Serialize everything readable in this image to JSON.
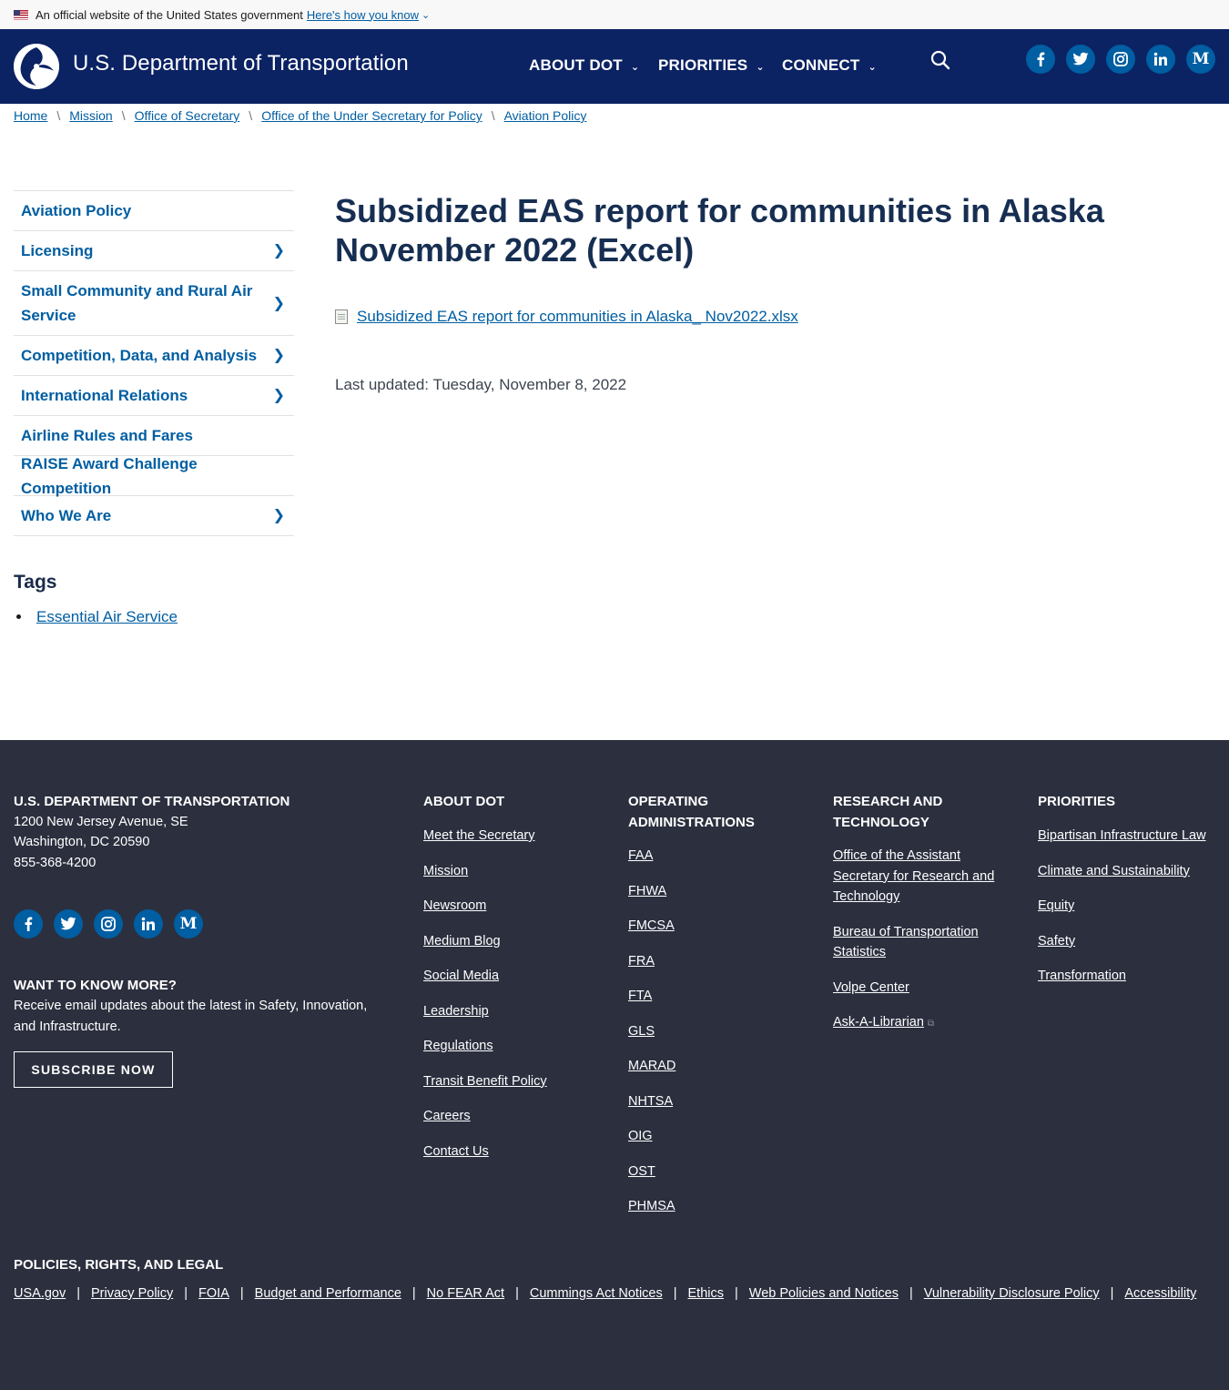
{
  "gov_banner": {
    "text": "An official website of the United States government",
    "link": "Here's how you know"
  },
  "header": {
    "site_title": "U.S. Department of Transportation",
    "nav": [
      {
        "label": "ABOUT DOT"
      },
      {
        "label": "PRIORITIES"
      },
      {
        "label": "CONNECT"
      }
    ],
    "social": [
      "facebook-icon",
      "twitter-icon",
      "instagram-icon",
      "linkedin-icon",
      "medium-icon"
    ]
  },
  "breadcrumb": [
    "Home",
    "Mission",
    "Office of Secretary",
    "Office of the Under Secretary for Policy",
    "Aviation Policy"
  ],
  "sidebar": {
    "items": [
      {
        "label": "Aviation Policy",
        "has_children": false
      },
      {
        "label": "Licensing",
        "has_children": true
      },
      {
        "label": "Small Community and Rural Air Service",
        "has_children": true
      },
      {
        "label": "Competition, Data, and Analysis",
        "has_children": true
      },
      {
        "label": "International Relations",
        "has_children": true
      },
      {
        "label": "Airline Rules and Fares",
        "has_children": false
      },
      {
        "label": "RAISE Award Challenge Competition",
        "has_children": false
      },
      {
        "label": "Who We Are",
        "has_children": true
      }
    ],
    "tags_title": "Tags",
    "tags": [
      "Essential Air Service"
    ]
  },
  "main": {
    "title": "Subsidized EAS report for communities in Alaska November 2022 (Excel)",
    "file_link": "Subsidized EAS report for communities in Alaska_ Nov2022.xlsx",
    "last_updated": "Last updated: Tuesday, November 8, 2022"
  },
  "footer": {
    "org_title": "U.S. DEPARTMENT OF TRANSPORTATION",
    "address1": "1200 New Jersey Avenue, SE",
    "address2": "Washington, DC 20590",
    "phone": "855-368-4200",
    "want_title": "WANT TO KNOW MORE?",
    "want_text": "Receive email updates about the latest in Safety, Innovation, and Infrastructure.",
    "subscribe": "SUBSCRIBE NOW",
    "about_title": "ABOUT DOT",
    "about_links": [
      "Meet the Secretary",
      "Mission",
      "Newsroom",
      "Medium Blog",
      "Social Media",
      "Leadership",
      "Regulations",
      "Transit Benefit Policy",
      "Careers",
      "Contact Us"
    ],
    "ops_title": "OPERATING ADMINISTRATIONS",
    "ops_links": [
      "FAA",
      "FHWA",
      "FMCSA",
      "FRA",
      "FTA",
      "GLS",
      "MARAD",
      "NHTSA",
      "OIG",
      "OST",
      "PHMSA"
    ],
    "research_title": "RESEARCH AND TECHNOLOGY",
    "research_links": [
      "Office of the Assistant Secretary for Research and Technology",
      "Bureau of Transportation Statistics",
      "Volpe Center",
      "Ask-A-Librarian"
    ],
    "priorities_title": "PRIORITIES",
    "priorities_links": [
      "Bipartisan Infrastructure Law",
      "Climate and Sustainability",
      "Equity",
      "Safety",
      "Transformation"
    ],
    "legal_title": "POLICIES, RIGHTS, AND LEGAL",
    "legal_links": [
      "USA.gov",
      "Privacy Policy",
      "FOIA",
      "Budget and Performance",
      "No FEAR Act",
      "Cummings Act Notices",
      "Ethics",
      "Web Policies and Notices",
      "Vulnerability Disclosure Policy",
      "Accessibility"
    ]
  },
  "colors": {
    "header_bg": "#0b2263",
    "link": "#005ea2",
    "title": "#162e51",
    "footer_bg": "#2b2f3e",
    "social_bg": "#005ea2"
  }
}
